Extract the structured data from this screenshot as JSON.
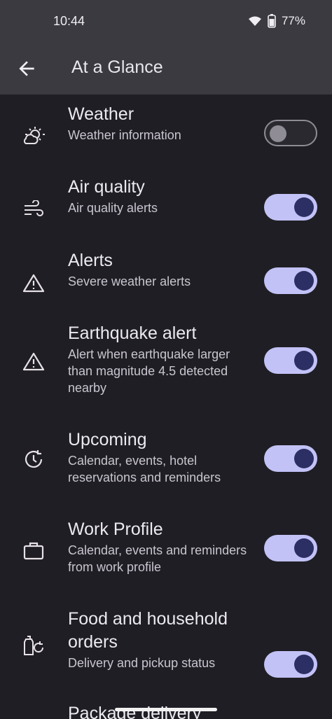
{
  "status": {
    "time": "10:44",
    "battery": "77%"
  },
  "appbar": {
    "title": "At a Glance"
  },
  "items": [
    {
      "label": "Weather",
      "desc": "Weather information",
      "on": false,
      "icon": "weather-icon"
    },
    {
      "label": "Air quality",
      "desc": "Air quality alerts",
      "on": true,
      "icon": "wind-icon"
    },
    {
      "label": "Alerts",
      "desc": "Severe weather alerts",
      "on": true,
      "icon": "warning-icon"
    },
    {
      "label": "Earthquake alert",
      "desc": "Alert when earthquake larger than magnitude 4.5 detected nearby",
      "on": true,
      "icon": "warning-icon"
    },
    {
      "label": "Upcoming",
      "desc": "Calendar, events, hotel reservations and reminders",
      "on": true,
      "icon": "clock-icon"
    },
    {
      "label": "Work Profile",
      "desc": "Calendar, events and reminders from work profile",
      "on": true,
      "icon": "briefcase-icon"
    },
    {
      "label": "Food and household orders",
      "desc": "Delivery and pickup status",
      "on": true,
      "icon": "order-icon"
    },
    {
      "label": "Package delivery",
      "desc": "",
      "on": null,
      "icon": ""
    }
  ]
}
